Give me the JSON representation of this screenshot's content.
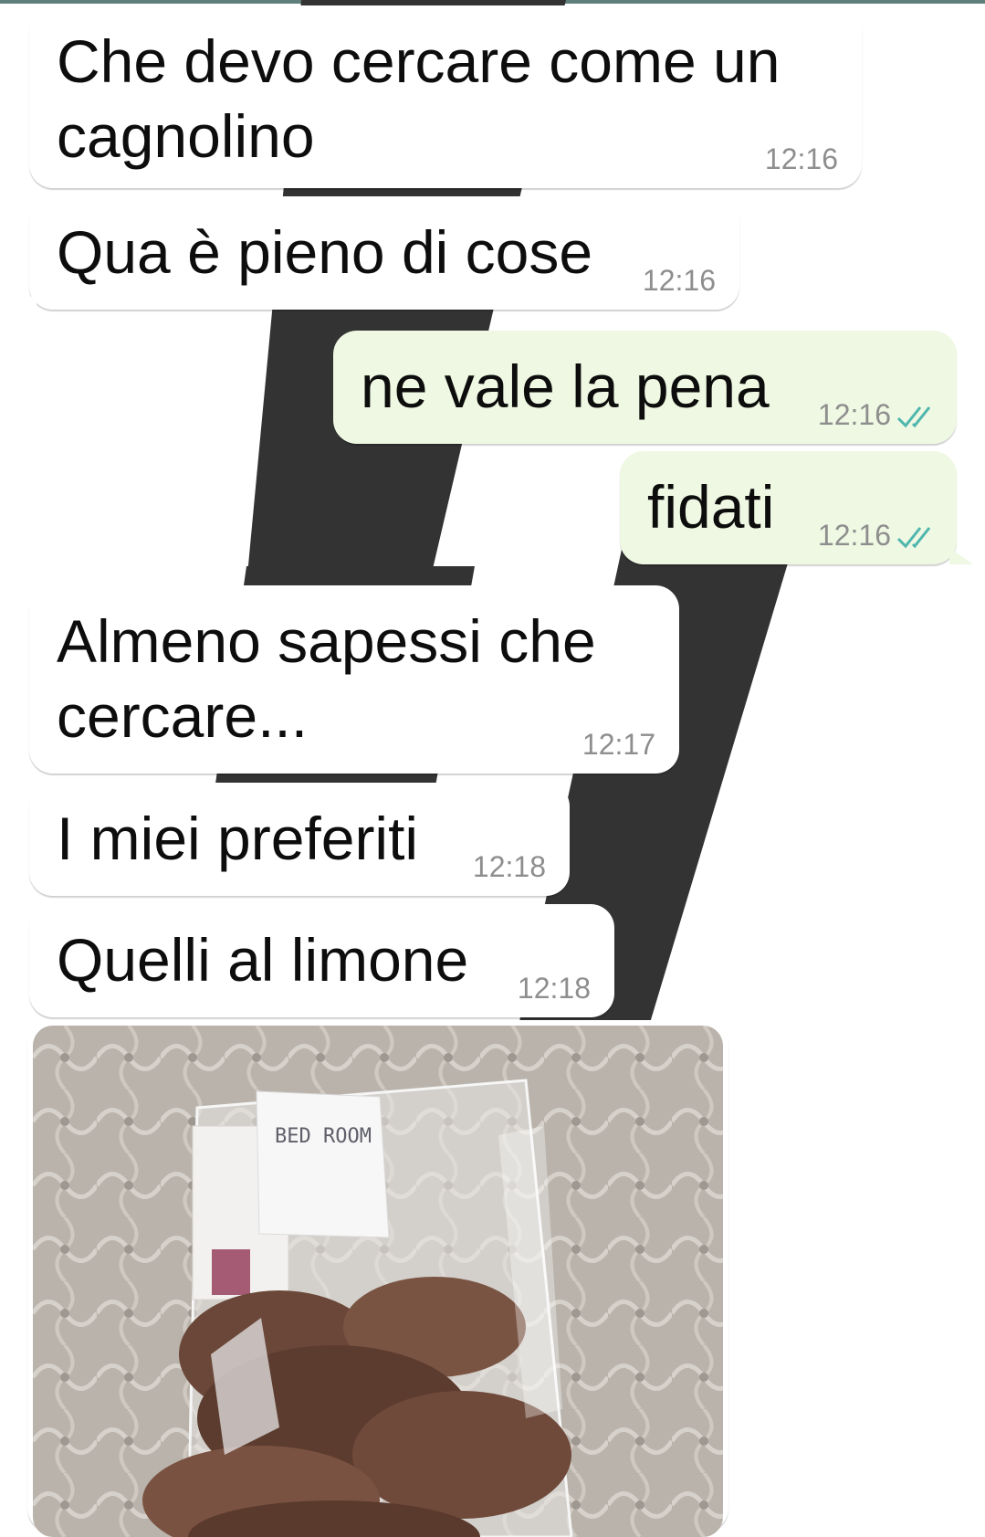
{
  "colors": {
    "incoming_bubble": "#ffffff",
    "outgoing_bubble": "#eef8e2",
    "timestamp": "#8e8e8e",
    "read_ticks": "#4fb6ae",
    "wallpaper_stripe": "#333333"
  },
  "messages": [
    {
      "direction": "incoming",
      "text": "Che devo cercare come un cagnolino",
      "time": "12:16"
    },
    {
      "direction": "incoming",
      "text": "Qua è pieno di cose",
      "time": "12:16"
    },
    {
      "direction": "outgoing",
      "text": "ne vale la pena",
      "time": "12:16",
      "status": "read-double-check-icon"
    },
    {
      "direction": "outgoing",
      "text": "fidati",
      "time": "12:16",
      "status": "read-double-check-icon"
    },
    {
      "direction": "incoming",
      "text": "Almeno sapessi che cercare...",
      "time": "12:17"
    },
    {
      "direction": "incoming",
      "text": "I miei preferiti",
      "time": "12:18"
    },
    {
      "direction": "incoming",
      "text": "Quelli al limone",
      "time": "12:18"
    },
    {
      "direction": "incoming",
      "type": "photo",
      "photo_note_text": "BED ROOM"
    }
  ]
}
